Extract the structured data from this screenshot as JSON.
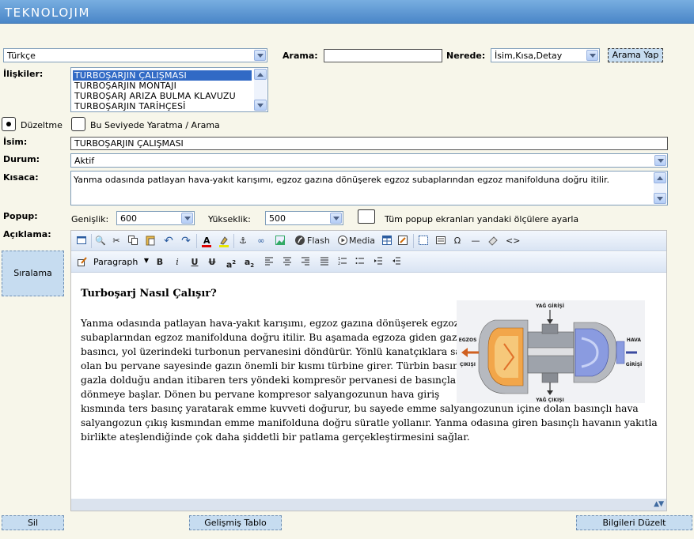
{
  "header": {
    "logo": "TEKNOLOJIM"
  },
  "search": {
    "language": "Türkçe",
    "arama_label": "Arama:",
    "arama_value": "",
    "nerede_label": "Nerede:",
    "nerede_value": "İsim,Kısa,Detay",
    "button": "Arama Yap"
  },
  "iliskiler": {
    "label": "İlişkiler:",
    "items": [
      "TURBOŞARJIN ÇALIŞMASI",
      "TURBOŞARJIN MONTAJI",
      "TURBOŞARJ ARIZA BULMA KLAVUZU",
      "TURBOŞARJIN TARİHÇESİ"
    ],
    "selected_index": 0
  },
  "mode": {
    "duzeltme": "Düzeltme",
    "yaratma": "Bu Seviyede Yaratma / Arama",
    "selected": "duzeltme"
  },
  "fields": {
    "isim_label": "İsim:",
    "isim_value": "TURBOŞARJIN ÇALIŞMASI",
    "durum_label": "Durum:",
    "durum_value": "Aktif",
    "kisaca_label": "Kısaca:",
    "kisaca_value": "Yanma odasında patlayan hava-yakıt karışımı, egzoz gazına dönüşerek egzoz subaplarından egzoz manifolduna doğru itilir."
  },
  "popup": {
    "label": "Popup:",
    "genislik_label": "Genişlik:",
    "genislik_value": "600",
    "yukseklik_label": "Yükseklik:",
    "yukseklik_value": "500",
    "all_label": "Tüm popup ekranları yandaki ölçülere ayarla"
  },
  "aciklama": {
    "label": "Açıklama:"
  },
  "editor": {
    "flash_label": "Flash",
    "media_label": "Media",
    "format_value": "Paragraph",
    "heading": "Turboşarj Nasıl Çalışır?",
    "lines": [
      "Yanma odasında patlayan hava-yakıt karışımı, egzoz gazına dönüşerek egzoz",
      "subaplarından egzoz manifolduna doğru itilir. Bu aşamada egzoza giden gazın",
      "basıncı, yol üzerindeki turbonun pervanesini döndürür. Yönlü kanatçıklara sahip",
      "olan bu pervane sayesinde gazın önemli bir kısmı türbine girer. Türbin basınçlı",
      "gazla dolduğu andan itibaren ters yöndeki kompresör pervanesi de basınçla",
      "dönmeye başlar. Dönen bu pervane kompresor salyangozunun hava giriş",
      "kısmında ters basınç yaratarak emme kuvveti doğurur, bu sayede emme salyangozunun içine dolan basınçlı hava",
      "salyangozun çıkış kısmından emme manifolduna doğru süratle yollanır.  Yanma  odasına  giren basınçlı havanın yakıtla",
      "birlikte ateşlendiğinde çok daha şiddetli bir patlama gerçekleştirmesini sağlar."
    ],
    "image_labels": {
      "top": "YAĞ GİRİŞİ",
      "left1": "EGZOS",
      "left2": "ÇIKIŞI",
      "right1": "HAVA",
      "right2": "GİRİŞİ",
      "bottom": "YAĞ ÇIKIŞI"
    }
  },
  "sidebar": {
    "siralama": "Sıralama"
  },
  "footer": {
    "sil": "Sil",
    "gelismis": "Gelişmiş Tablo",
    "bilgileri": "Bilgileri Düzelt"
  }
}
